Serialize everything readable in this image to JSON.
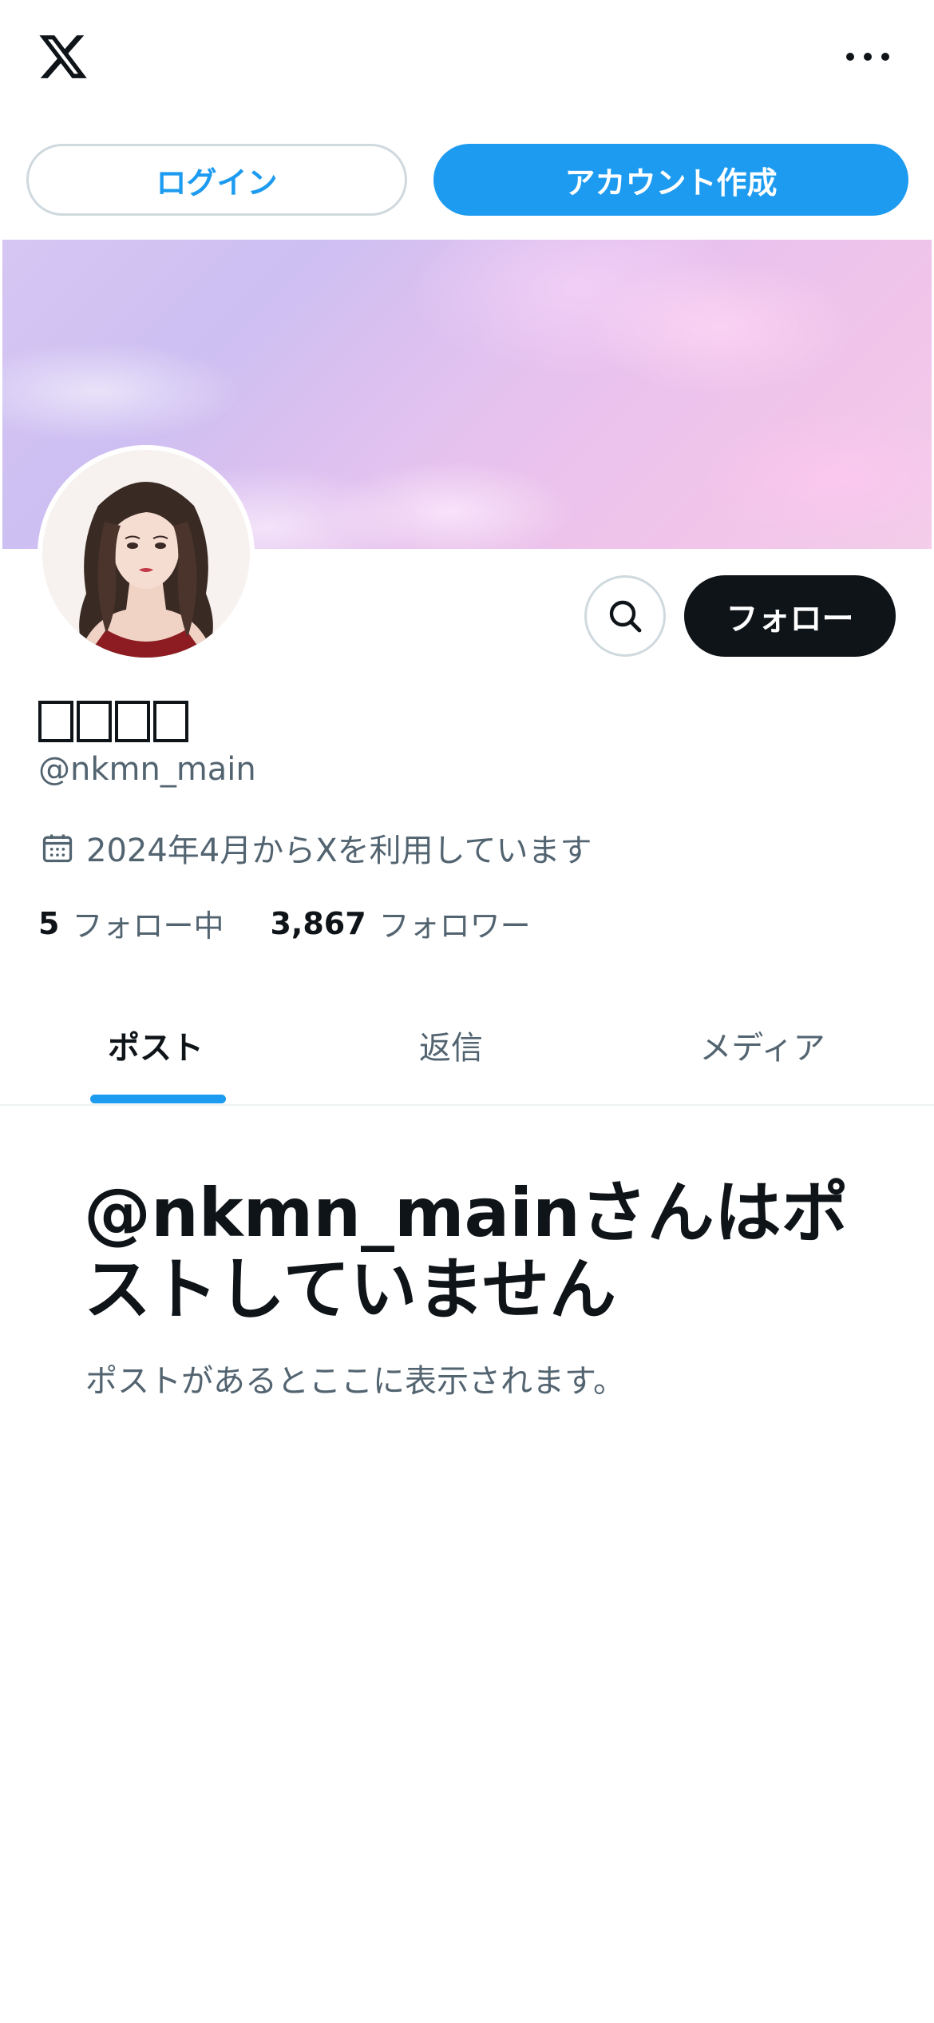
{
  "header": {
    "logo_icon": "x-logo-icon",
    "more_icon": "more-horizontal-icon"
  },
  "auth": {
    "login_label": "ログイン",
    "signup_label": "アカウント作成"
  },
  "profile": {
    "display_name": "",
    "handle": "@nkmn_main",
    "joined": "2024年4月からXを利用しています",
    "following_count": "5",
    "following_label": "フォロー中",
    "followers_count": "3,867",
    "followers_label": "フォロワー",
    "follow_label": "フォロー",
    "search_icon": "search-icon"
  },
  "tabs": [
    {
      "label": "ポスト",
      "active": true
    },
    {
      "label": "返信",
      "active": false
    },
    {
      "label": "メディア",
      "active": false
    }
  ],
  "empty_state": {
    "title": "@nkmn_mainさんはポストしていません",
    "subtitle": "ポストがあるとここに表示されます。"
  },
  "colors": {
    "accent": "#1d9bf0",
    "text_primary": "#0f1419",
    "text_secondary": "#536471",
    "border": "#cfd9de"
  }
}
